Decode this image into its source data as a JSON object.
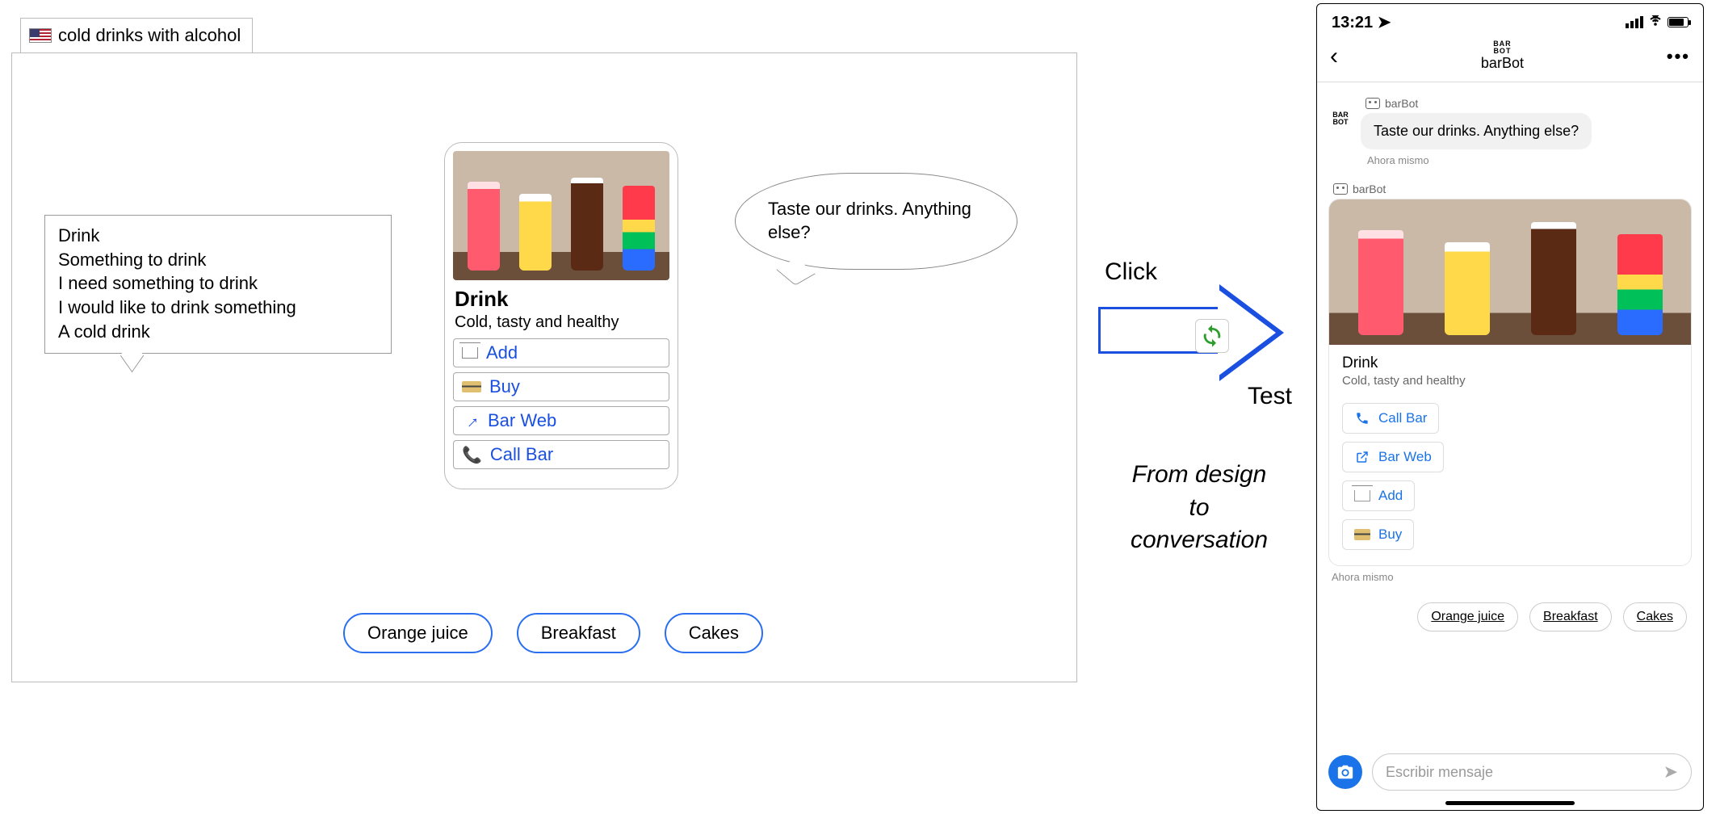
{
  "designer": {
    "tab_label": "cold drinks with alcohol",
    "intents": [
      "Drink",
      "Something to drink",
      "I need something to drink",
      "I would like to drink something",
      "A cold drink"
    ],
    "card": {
      "title": "Drink",
      "subtitle": "Cold, tasty and healthy",
      "buttons": {
        "add": "Add",
        "buy": "Buy",
        "web": "Bar Web",
        "call": "Call Bar"
      }
    },
    "response_bubble": "Taste our drinks. Anything else?",
    "chips": [
      "Orange juice",
      "Breakfast",
      "Cakes"
    ]
  },
  "middle": {
    "click": "Click",
    "test": "Test",
    "tagline_l1": "From design",
    "tagline_l2": "to",
    "tagline_l3": "conversation"
  },
  "phone": {
    "time": "13:21",
    "bot_name": "barBot",
    "logo_l1": "BAR",
    "logo_l2": "BOT",
    "message": "Taste our drinks. Anything else?",
    "timestamp": "Ahora mismo",
    "card": {
      "title": "Drink",
      "subtitle": "Cold, tasty and healthy",
      "call": "Call Bar",
      "web": "Bar Web",
      "add": "Add",
      "buy": "Buy"
    },
    "timestamp2": "Ahora mismo",
    "quick_replies": [
      "Orange juice",
      "Breakfast",
      "Cakes"
    ],
    "input_placeholder": "Escribir mensaje"
  }
}
